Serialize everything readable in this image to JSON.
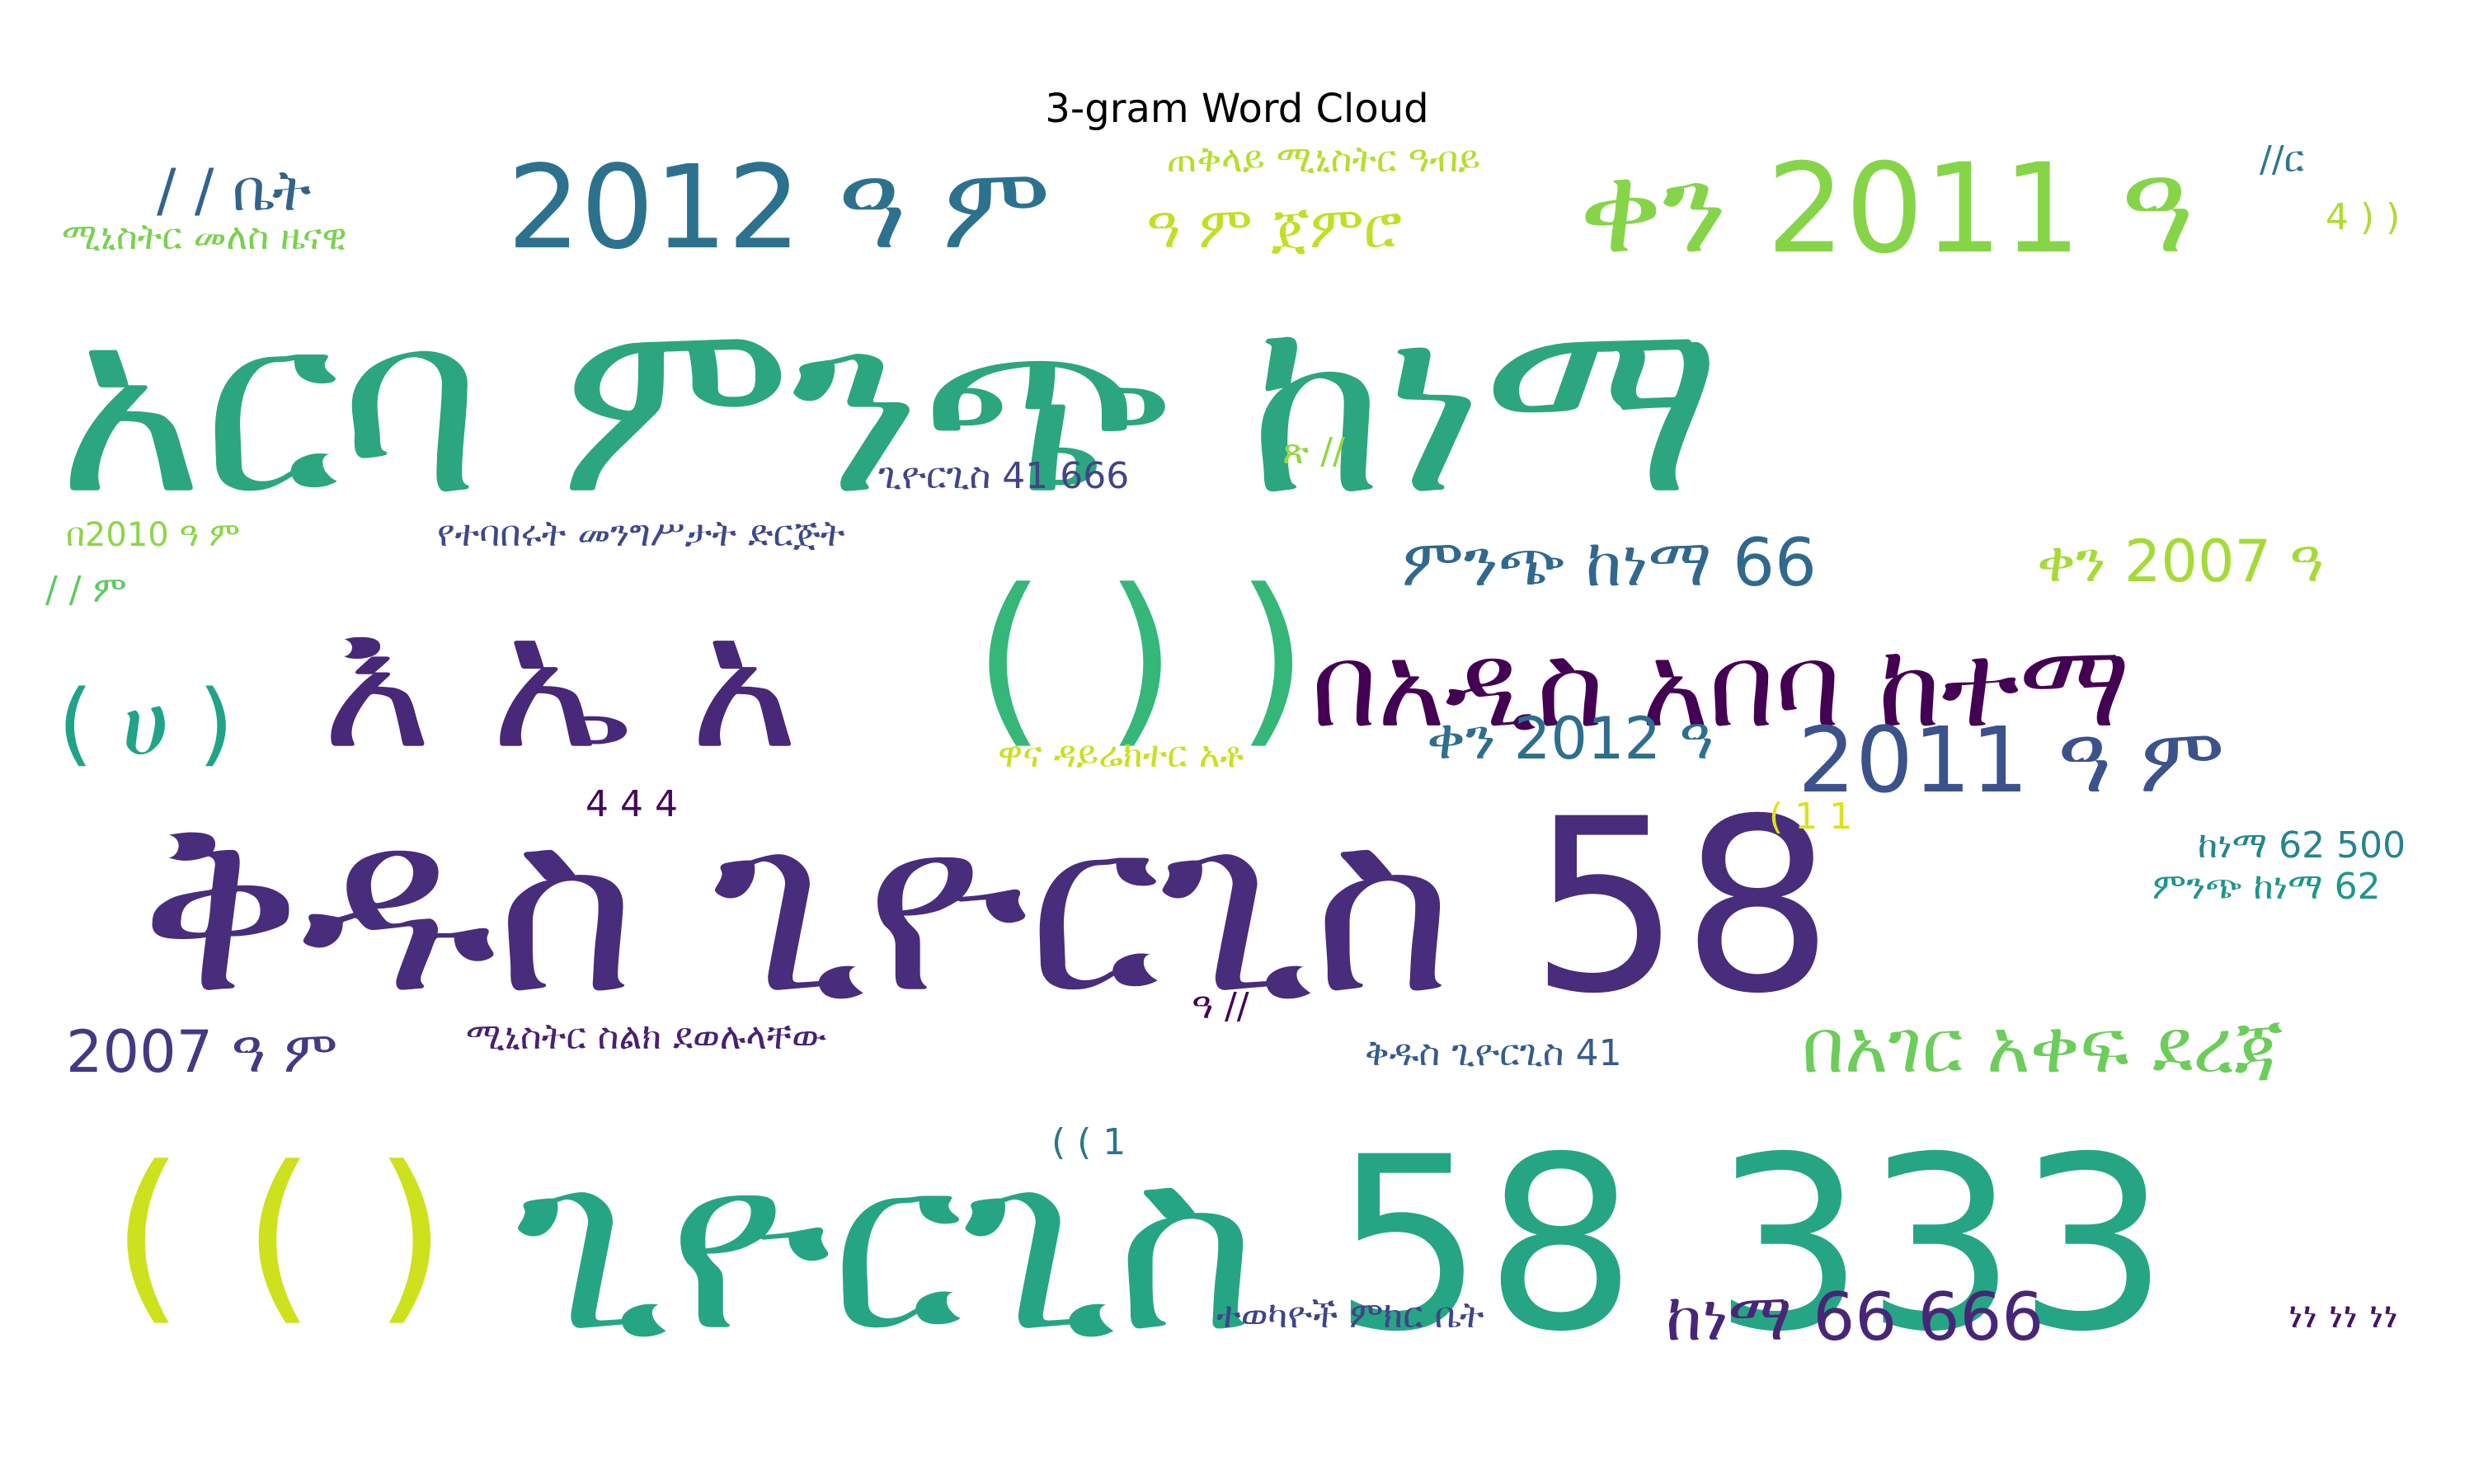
{
  "chart_data": {
    "type": "wordcloud",
    "title": "3-gram Word Cloud",
    "background": "#ffffff",
    "colormap": "viridis",
    "words": [
      {
        "text": "አርባ ምንጭ ከነማ",
        "color": "#2ca67f"
      },
      {
        "text": "ቅዱስ ጊዮርጊስ 58",
        "color": "#472d7b"
      },
      {
        "text": "ጊዮርጊስ 58 333",
        "color": "#26a585"
      },
      {
        "text": "እ ኤ አ",
        "color": "#482878"
      },
      {
        "text": "( ( )",
        "color": "#cde11d"
      },
      {
        "text": "( ) )",
        "color": "#35b779"
      },
      {
        "text": "በአዲስ አበባ ከተማ",
        "color": "#440154"
      },
      {
        "text": "ቀን 2011 ዓ",
        "color": "#86d549"
      },
      {
        "text": "2012 ዓ ም",
        "color": "#2c728e"
      },
      {
        "text": "2011 ዓ ም",
        "color": "#3b528b"
      },
      {
        "text": "( ሀ )",
        "color": "#20a386"
      },
      {
        "text": "በአገር አቀፍ ደረጃ",
        "color": "#6ccd5a"
      },
      {
        "text": "ከነማ 66 666",
        "color": "#482677"
      },
      {
        "text": "ምንጭ ከነማ 66",
        "color": "#31688e"
      },
      {
        "text": "ቀን 2007 ዓ",
        "color": "#a5db36"
      },
      {
        "text": "2007 ዓ ም",
        "color": "#443983"
      },
      {
        "text": "ቀን 2012 ዓ",
        "color": "#2e6e8e"
      },
      {
        "text": "ዓ ም ጀምሮ",
        "color": "#c2df23"
      },
      {
        "text": "/ / ቤት",
        "color": "#33638d"
      },
      {
        "text": "ጠቅላይ ሚኒስትር ዓብይ",
        "color": "#b5de2b"
      },
      {
        "text": "ሚኒስትር መለስ ዜናዊ",
        "color": "#7ad151"
      },
      {
        "text": "//ር",
        "color": "#2a788e"
      },
      {
        "text": "4 ) )",
        "color": "#addc30"
      },
      {
        "text": "ጊዮርጊስ 41 666",
        "color": "#414487"
      },
      {
        "text": "ጽ //",
        "color": "#90d743"
      },
      {
        "text": "በ2010 ዓ ም",
        "color": "#8bd646"
      },
      {
        "text": "የተባበሩት መንግሥታት ድርጅት",
        "color": "#3e4989"
      },
      {
        "text": "/ / ም",
        "color": "#5ec962"
      },
      {
        "text": "ዋና ዳይሬክተር አቶ",
        "color": "#c8e020"
      },
      {
        "text": "4 4 4",
        "color": "#46085c"
      },
      {
        "text": "( 1 1",
        "color": "#dde318"
      },
      {
        "text": "ከነማ 62 500",
        "color": "#25848e"
      },
      {
        "text": "ምንጭ ከነማ 62",
        "color": "#1f958b"
      },
      {
        "text": "ዓ //",
        "color": "#440256"
      },
      {
        "text": "ሚኒስትር ስልክ ደወሉላቸው",
        "color": "#482173"
      },
      {
        "text": "ቅዱስ ጊዮርጊስ 41",
        "color": "#365c8d"
      },
      {
        "text": "( ( 1",
        "color": "#2a768e"
      },
      {
        "text": "ተወካዮች ምክር ቤት",
        "color": "#404588"
      },
      {
        "text": "ነነ ነነ ነነ",
        "color": "#471164"
      }
    ]
  }
}
